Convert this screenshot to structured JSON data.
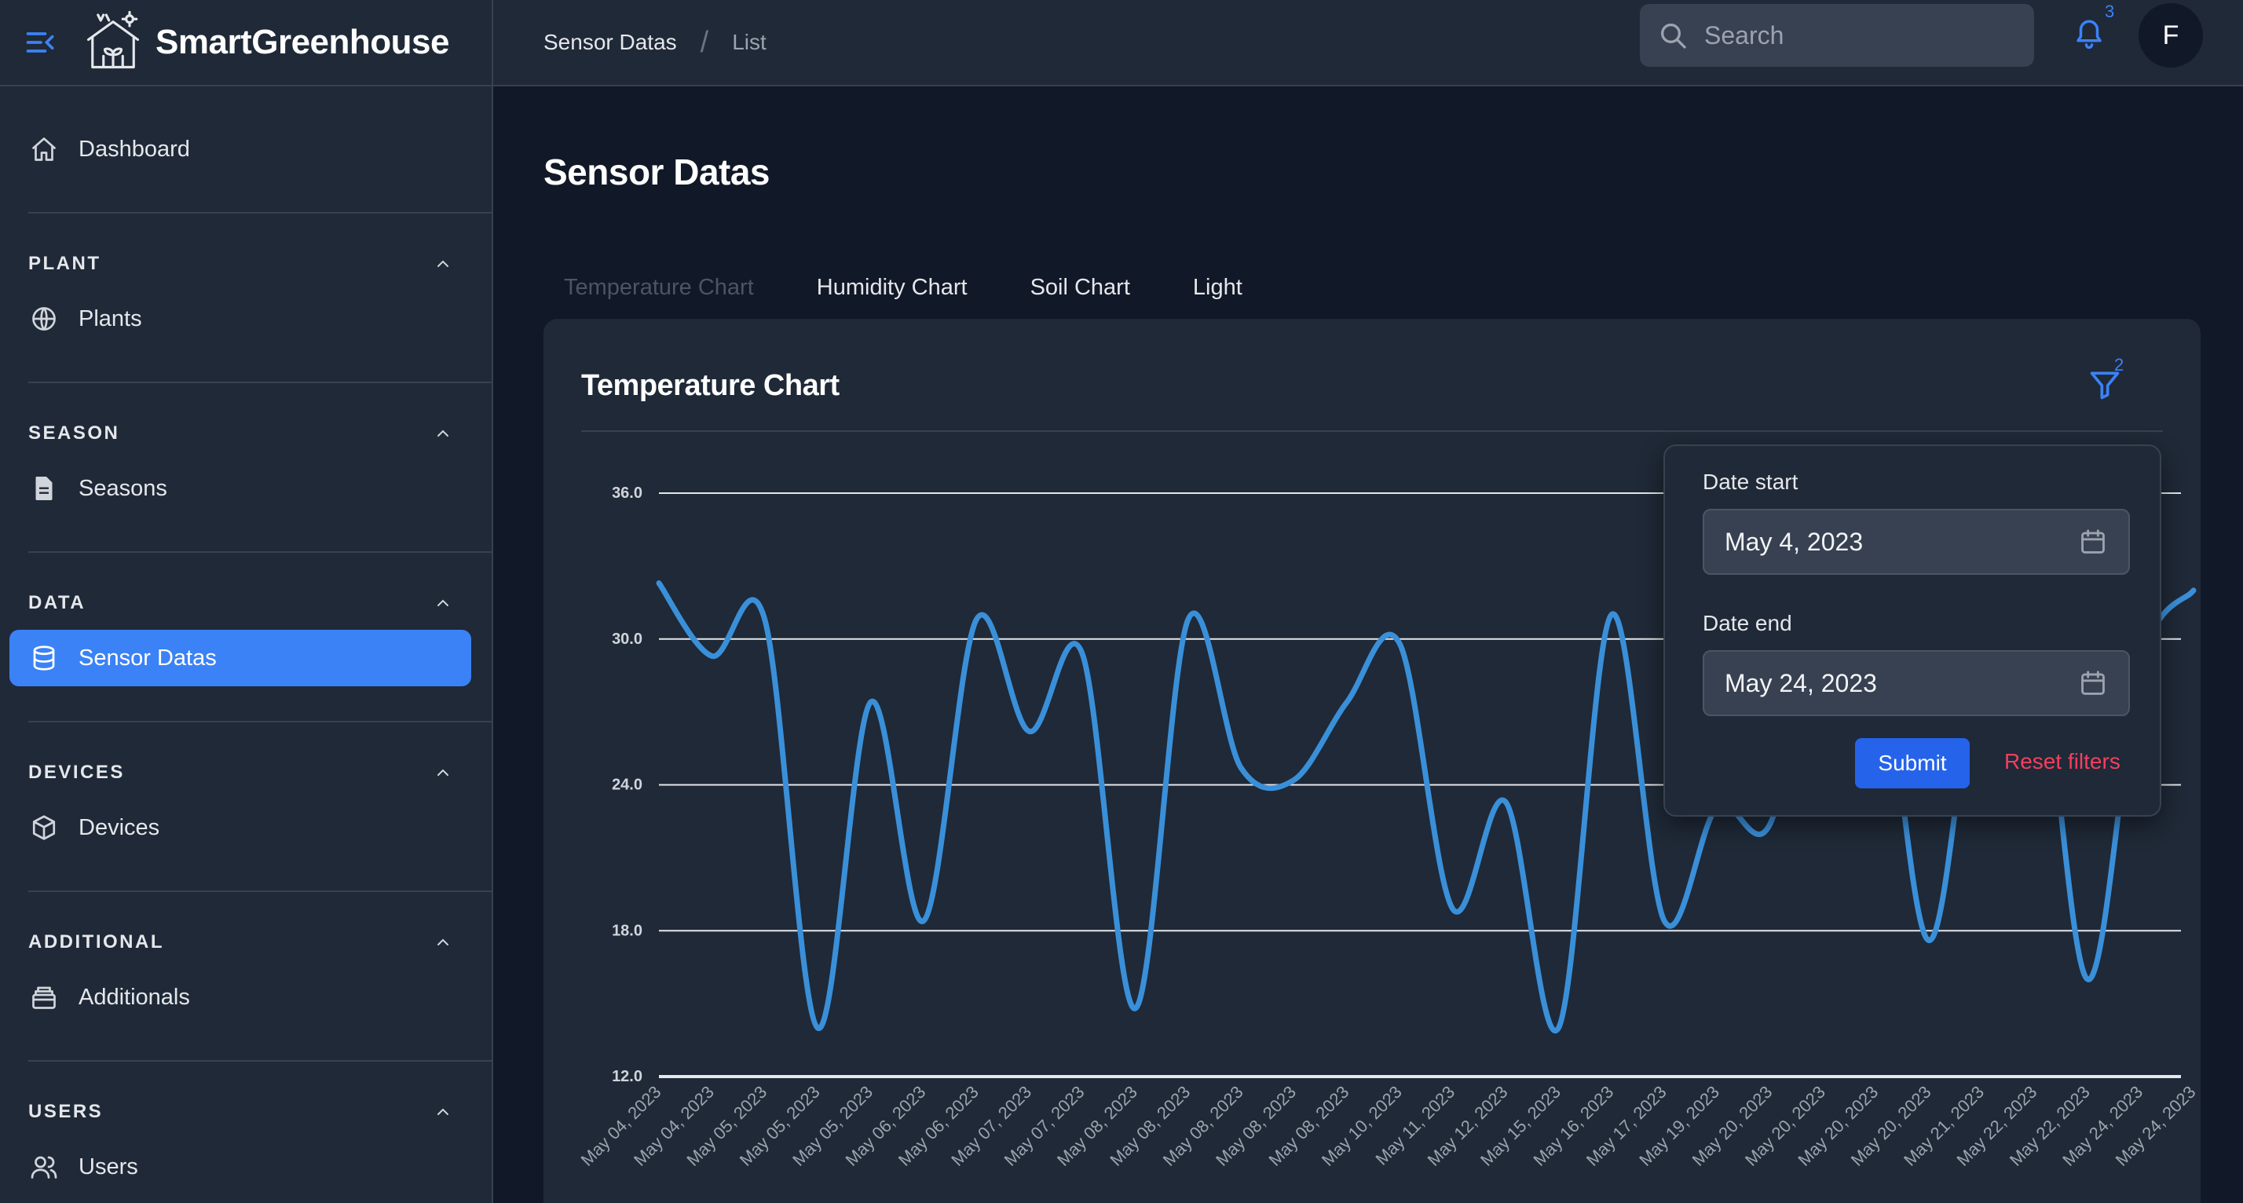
{
  "app": {
    "brand": "SmartGreenhouse",
    "icon_menu": "menu-collapse-icon",
    "icon_logo": "greenhouse-logo-icon"
  },
  "sidebar": {
    "dashboard": "Dashboard",
    "sections": [
      {
        "title": "PLANT",
        "item": "Plants",
        "icon": "globe-icon",
        "active": false
      },
      {
        "title": "SEASON",
        "item": "Seasons",
        "icon": "document-icon",
        "active": false
      },
      {
        "title": "DATA",
        "item": "Sensor Datas",
        "icon": "database-icon",
        "active": true
      },
      {
        "title": "DEVICES",
        "item": "Devices",
        "icon": "cube-icon",
        "active": false
      },
      {
        "title": "ADDITIONAL",
        "item": "Additionals",
        "icon": "archive-icon",
        "active": false
      },
      {
        "title": "USERS",
        "item": "Users",
        "icon": "users-icon",
        "active": false
      }
    ]
  },
  "header": {
    "breadcrumb": [
      "Sensor Datas",
      "List"
    ],
    "search_placeholder": "Search",
    "notification_count": "3",
    "avatar_initial": "F"
  },
  "page": {
    "title": "Sensor Datas",
    "tabs": [
      "Temperature Chart",
      "Humidity Chart",
      "Soil Chart",
      "Light"
    ],
    "active_tab": 0
  },
  "card": {
    "title": "Temperature Chart",
    "filter_count": "2"
  },
  "filter": {
    "date_start_label": "Date start",
    "date_start_value": "May 4, 2023",
    "date_end_label": "Date end",
    "date_end_value": "May 24, 2023",
    "submit_label": "Submit",
    "reset_label": "Reset filters"
  },
  "colors": {
    "accent": "#3b82f6",
    "line": "#3a8fd9",
    "danger": "#f43f5e",
    "background": "#111827",
    "panel": "#1f2937"
  },
  "chart_data": {
    "type": "line",
    "x": [
      "May 04, 2023",
      "May 04, 2023",
      "May 05, 2023",
      "May 05, 2023",
      "May 05, 2023",
      "May 06, 2023",
      "May 06, 2023",
      "May 07, 2023",
      "May 07, 2023",
      "May 08, 2023",
      "May 08, 2023",
      "May 08, 2023",
      "May 08, 2023",
      "May 08, 2023",
      "May 10, 2023",
      "May 11, 2023",
      "May 12, 2023",
      "May 15, 2023",
      "May 16, 2023",
      "May 17, 2023",
      "May 19, 2023",
      "May 20, 2023",
      "May 20, 2023",
      "May 20, 2023",
      "May 20, 2023",
      "May 21, 2023",
      "May 22, 2023",
      "May 22, 2023",
      "May 24, 2023",
      "May 24, 2023"
    ],
    "series": [
      {
        "values": [
          32.3,
          29.3,
          30.8,
          14.0,
          27.4,
          18.4,
          30.8,
          26.2,
          29.4,
          14.8,
          30.8,
          24.7,
          24.2,
          27.4,
          29.8,
          18.9,
          23.3,
          14.0,
          31.0,
          18.4,
          23.1,
          22.4,
          32.0,
          31.0,
          17.6,
          30.2,
          31.0,
          16.0,
          29.0,
          32.0
        ]
      }
    ],
    "yticks": [
      "12.0",
      "18.0",
      "24.0",
      "30.0",
      "36.0"
    ],
    "ylim": [
      12,
      36
    ],
    "grid": true,
    "title": "",
    "xlabel": "",
    "ylabel": ""
  }
}
